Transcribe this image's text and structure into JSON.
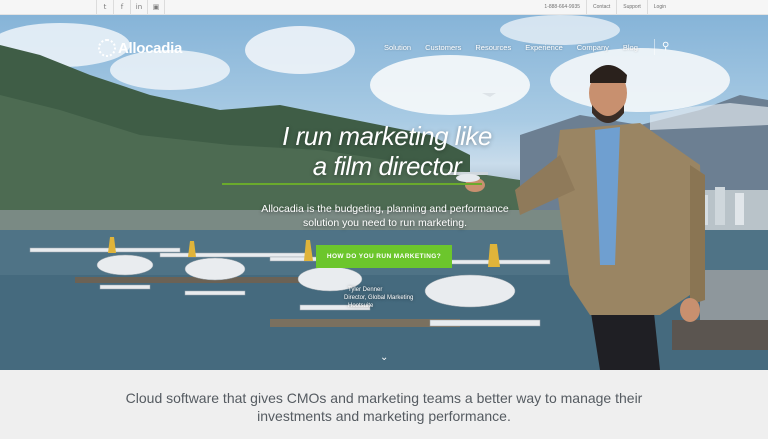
{
  "topbar": {
    "social": [
      {
        "icon": "twitter-icon",
        "glyph": "t"
      },
      {
        "icon": "facebook-icon",
        "glyph": "f"
      },
      {
        "icon": "linkedin-icon",
        "glyph": "in"
      },
      {
        "icon": "instagram-icon",
        "glyph": "▣"
      }
    ],
    "phone": "1-888-664-9935",
    "links": [
      "Contact",
      "Support",
      "Login"
    ]
  },
  "brand": {
    "name": "Allocadia"
  },
  "nav": {
    "items": [
      "Solution",
      "Customers",
      "Resources",
      "Experience",
      "Company",
      "Blog"
    ],
    "search_icon": "search-icon"
  },
  "hero": {
    "headline_line1": "I run marketing like",
    "headline_line2": "a film director",
    "subhead_line1": "Allocadia is the budgeting, planning and performance",
    "subhead_line2": "solution you need to run marketing.",
    "cta_label": "HOW DO YOU RUN MARKETING?",
    "caption_name": "Tyler Denner",
    "caption_title": "Director, Global Marketing",
    "caption_company": "Hootsuite",
    "scroll_icon": "chevron-down-icon"
  },
  "tagline": {
    "line1": "Cloud software that gives CMOs and marketing teams a better way to manage their",
    "line2": "investments and marketing performance."
  },
  "colors": {
    "accent_green": "#6cc62c",
    "rule_green": "#6aaa2c",
    "tagline_text": "#555b61"
  }
}
